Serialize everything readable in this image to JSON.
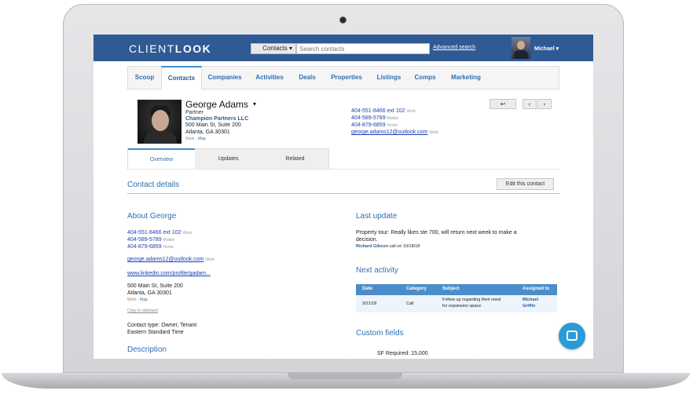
{
  "app": {
    "logo_light": "CLIENT",
    "logo_bold": "LOOK",
    "search_select": "Contacts ▾",
    "search_placeholder": "Search contacts",
    "advanced_search": "Advanced search",
    "user_name": "Michael ▾"
  },
  "nav": {
    "items": [
      "Scoop",
      "Contacts",
      "Companies",
      "Activities",
      "Deals",
      "Properties",
      "Listings",
      "Comps",
      "Marketing"
    ],
    "active": "Contacts"
  },
  "contact": {
    "name": "George Adams",
    "caret": "▾",
    "title": "Partner",
    "company": "Champion Partners LLC",
    "address_line1": "500 Main St, Suite 200",
    "address_line2": "Atlanta, GA 30301",
    "address_label": "Work",
    "address_sep": " - ",
    "map_link": "Map",
    "phones": [
      {
        "number": "404-551-8466 ext 102",
        "label": "Work"
      },
      {
        "number": "404-589-5789",
        "label": "Mobile"
      },
      {
        "number": "404-879-6859",
        "label": "Home"
      }
    ],
    "email": "george.adams12@outlook.com",
    "email_label": "Work"
  },
  "header_buttons": {
    "back": "↩",
    "prev": "‹",
    "next": "›"
  },
  "subtabs": [
    "Overview",
    "Updates",
    "Related"
  ],
  "details": {
    "title": "Contact details",
    "edit_button": "Edit this contact",
    "about_title": "About George",
    "linkedin": "www.linkedin.com/profile/gadam...",
    "copy_clipboard": "Copy to clipboard",
    "contact_type": "Contact type: Owner, Tenant",
    "timezone": "Eastern Standard Time",
    "description_title": "Description"
  },
  "last_update": {
    "title": "Last update",
    "text_line1": "Property tour: Really likes ste 700, will return next week to make a",
    "text_line2": "decision.",
    "author": "Richard Gibson",
    "meta": " call on 10/18/18"
  },
  "next_activity": {
    "title": "Next activity",
    "columns": [
      "Date",
      "Category",
      "Subject",
      "Assigned to"
    ],
    "row": {
      "date": "3/21/18",
      "category": "Call",
      "subject_line1": "Follow up regarding their need",
      "subject_line2": "for expansion space",
      "assigned_line1": "Michael",
      "assigned_line2": "Griffin"
    }
  },
  "custom_fields": {
    "title": "Custom fields",
    "sf_label": "SF Required:",
    "sf_value": "15,000"
  },
  "colors": {
    "brand_blue": "#2f5a94",
    "accent_blue": "#2f6fb0",
    "link_blue": "#1a3fb5",
    "table_header": "#4b8dcb",
    "chat_button": "#2b9bd6"
  }
}
